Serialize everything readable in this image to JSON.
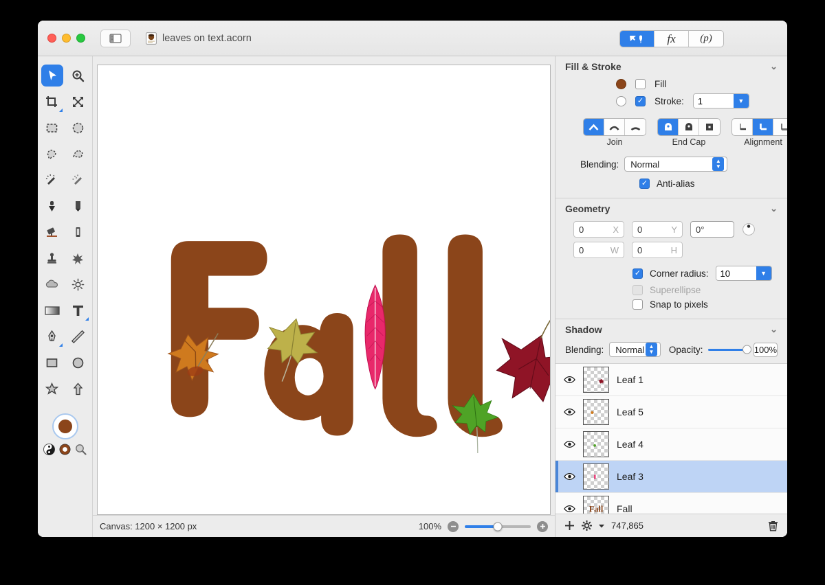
{
  "window": {
    "document_title": "leaves on text.acorn",
    "traffic_lights": [
      "close",
      "minimize",
      "zoom"
    ],
    "sidebar_toggle_icon": "sidebar-icon",
    "document_icon": "acorn-document-icon"
  },
  "inspector_tabs": [
    {
      "label": "",
      "icon": "tool-options-icon",
      "active": true
    },
    {
      "label": "fx",
      "icon": "effects-icon",
      "active": false
    },
    {
      "label": "(p)",
      "icon": "palette-icon",
      "active": false
    }
  ],
  "fill_stroke": {
    "title": "Fill & Stroke",
    "collapse_icon": "chevron-down-icon",
    "fill_label": "Fill",
    "fill_checked": false,
    "fill_color": "#8b451a",
    "stroke_label": "Stroke:",
    "stroke_checked": true,
    "stroke_value": "1",
    "stroke_color": "#ffffff",
    "join_label": "Join",
    "join_options": [
      "miter-join",
      "round-join",
      "bevel-join"
    ],
    "join_selected": 0,
    "endcap_label": "End Cap",
    "endcap_options": [
      "butt-cap",
      "round-cap",
      "square-cap"
    ],
    "endcap_selected": 0,
    "alignment_label": "Alignment",
    "alignment_options": [
      "align-inner",
      "align-center",
      "align-outer"
    ],
    "alignment_selected": 1,
    "blending_label": "Blending:",
    "blending_value": "Normal",
    "antialias_label": "Anti-alias",
    "antialias_checked": true
  },
  "geometry": {
    "title": "Geometry",
    "collapse_icon": "chevron-down-icon",
    "x_value": "0",
    "x_suffix": "X",
    "y_value": "0",
    "y_suffix": "Y",
    "rotation_value": "0°",
    "rotation_knob_icon": "rotation-dial-icon",
    "w_value": "0",
    "w_suffix": "W",
    "h_value": "0",
    "h_suffix": "H",
    "corner_radius_label": "Corner radius:",
    "corner_radius_checked": true,
    "corner_radius_value": "10",
    "superellipse_label": "Superellipse",
    "superellipse_checked": false,
    "superellipse_disabled": true,
    "snap_label": "Snap to pixels",
    "snap_checked": false
  },
  "shadow": {
    "title": "Shadow",
    "collapse_icon": "chevron-down-icon",
    "blending_label": "Blending:",
    "blending_value": "Normal",
    "opacity_label": "Opacity:",
    "opacity_value": "100%"
  },
  "layers": {
    "items": [
      {
        "name": "Leaf 1",
        "visible": true,
        "selected": false,
        "thumb": "dark-red-leaf"
      },
      {
        "name": "Leaf 5",
        "visible": true,
        "selected": false,
        "thumb": "orange-leaf"
      },
      {
        "name": "Leaf 4",
        "visible": true,
        "selected": false,
        "thumb": "green-leaf"
      },
      {
        "name": "Leaf 3",
        "visible": true,
        "selected": true,
        "thumb": "pink-leaf"
      },
      {
        "name": "Fall",
        "visible": true,
        "selected": false,
        "thumb": "fall-text"
      }
    ],
    "footer": {
      "add_icon": "plus-icon",
      "settings_icon": "gear-icon",
      "settings_chevron": "chevron-down-icon",
      "memory": "747,865",
      "delete_icon": "trash-icon"
    }
  },
  "status_bar": {
    "canvas_info": "Canvas: 1200 × 1200 px",
    "zoom_level": "100%",
    "zoom_out_icon": "minus-icon",
    "zoom_in_icon": "plus-icon"
  },
  "toolbar": {
    "rows": [
      [
        {
          "icon": "arrow-select-tool",
          "selected": true
        },
        {
          "icon": "zoom-tool",
          "selected": false
        }
      ],
      [
        {
          "icon": "crop-tool",
          "selected": false,
          "corner": true
        },
        {
          "icon": "move-tool",
          "selected": false
        }
      ],
      [
        {
          "icon": "rect-select-tool",
          "selected": false
        },
        {
          "icon": "ellipse-select-tool",
          "selected": false
        }
      ],
      [
        {
          "icon": "lasso-tool",
          "selected": false
        },
        {
          "icon": "polygon-lasso-tool",
          "selected": false
        }
      ],
      [
        {
          "icon": "magic-wand-tool",
          "selected": false
        },
        {
          "icon": "instant-alpha-tool",
          "selected": false
        }
      ],
      [
        {
          "icon": "paint-bucket-tool",
          "selected": false
        },
        {
          "icon": "pencil-tool",
          "selected": false
        }
      ],
      [
        {
          "icon": "eraser-tool",
          "selected": false
        },
        {
          "icon": "brush-tool",
          "selected": false
        }
      ],
      [
        {
          "icon": "clone-stamp-tool",
          "selected": false
        },
        {
          "icon": "smudge-tool",
          "selected": false
        }
      ],
      [
        {
          "icon": "blur-tool",
          "selected": false
        },
        {
          "icon": "dodge-tool",
          "selected": false
        }
      ],
      [
        {
          "icon": "gradient-tool",
          "selected": false
        },
        {
          "icon": "text-tool",
          "selected": false,
          "corner": true
        }
      ],
      [
        {
          "icon": "bezier-pen-tool",
          "selected": false,
          "corner": true
        },
        {
          "icon": "line-tool",
          "selected": false
        }
      ],
      [
        {
          "icon": "rectangle-tool",
          "selected": false
        },
        {
          "icon": "ellipse-tool",
          "selected": false
        }
      ],
      [
        {
          "icon": "star-tool",
          "selected": false
        },
        {
          "icon": "arrow-shape-tool",
          "selected": false
        }
      ]
    ],
    "foreground_color": "#8b451a",
    "swatch_icon": "color-swatch",
    "bw_swatch_icon": "black-white-swatch-icon",
    "ring_swatch_icon": "stroke-color-icon",
    "loupe_icon": "color-picker-icon"
  },
  "canvas_art": {
    "text": "Fall",
    "text_color": "#8b451a",
    "leaves": [
      {
        "name": "orange-maple-leaf",
        "color": "#d2761f"
      },
      {
        "name": "yellow-maple-leaf",
        "color": "#b5a82f"
      },
      {
        "name": "pink-feather-leaf",
        "color": "#e8286a"
      },
      {
        "name": "green-maple-leaf",
        "color": "#4aa024"
      },
      {
        "name": "dark-red-maple-leaf",
        "color": "#8d1225"
      }
    ]
  }
}
